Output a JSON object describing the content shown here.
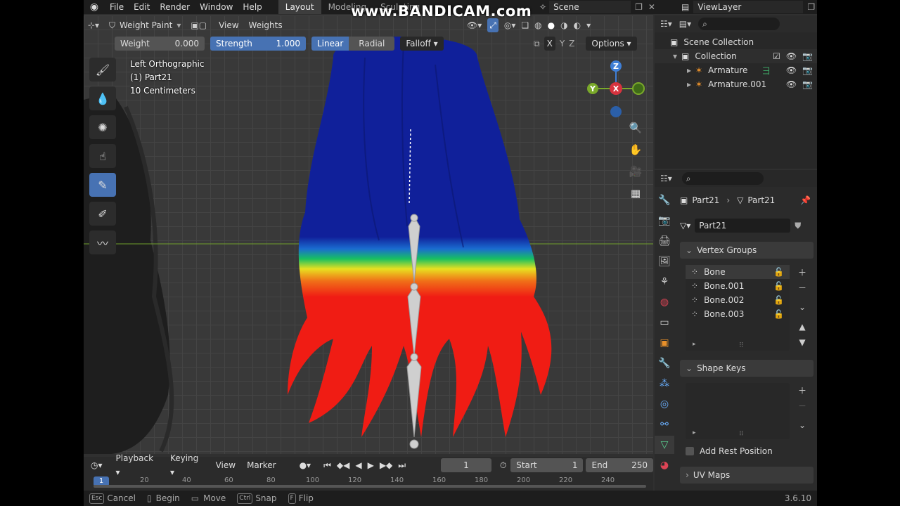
{
  "watermark": "www.BANDICAM.com",
  "topbar": {
    "menus": [
      "File",
      "Edit",
      "Render",
      "Window",
      "Help"
    ],
    "workspaces": [
      "Layout",
      "Modeling",
      "Sculpting"
    ],
    "scene": "Scene",
    "view_layer": "ViewLayer"
  },
  "viewport_header": {
    "mode": "Weight Paint",
    "view": "View",
    "weights": "Weights"
  },
  "tool_settings": {
    "weight_label": "Weight",
    "weight_value": "0.000",
    "strength_label": "Strength",
    "strength_value": "1.000",
    "linear": "Linear",
    "radial": "Radial",
    "falloff": "Falloff",
    "x": "X",
    "y": "Y",
    "z": "Z",
    "options": "Options"
  },
  "overlay": {
    "view_name": "Left Orthographic",
    "object": "(1) Part21",
    "scale": "10 Centimeters"
  },
  "gizmo": {
    "z": "Z",
    "y": "Y",
    "x": "X"
  },
  "outliner": {
    "scene_collection": "Scene Collection",
    "collection": "Collection",
    "items": [
      "Armature",
      "Armature.001"
    ]
  },
  "properties": {
    "breadcrumb_object": "Part21",
    "breadcrumb_mesh": "Part21",
    "mesh_name": "Part21",
    "vertex_groups_title": "Vertex Groups",
    "vertex_groups": [
      "Bone",
      "Bone.001",
      "Bone.002",
      "Bone.003"
    ],
    "shape_keys_title": "Shape Keys",
    "add_rest_position": "Add Rest Position",
    "uv_maps_title": "UV Maps"
  },
  "timeline": {
    "playback": "Playback",
    "keying": "Keying",
    "view": "View",
    "marker": "Marker",
    "current_frame": "1",
    "start_label": "Start",
    "start_value": "1",
    "end_label": "End",
    "end_value": "250",
    "ruler": [
      "1",
      "20",
      "40",
      "60",
      "80",
      "100",
      "120",
      "140",
      "160",
      "180",
      "200",
      "220",
      "240"
    ]
  },
  "status": {
    "esc_key": "Esc",
    "cancel": "Cancel",
    "begin": "Begin",
    "move": "Move",
    "ctrl_key": "Ctrl",
    "snap": "Snap",
    "f_key": "F",
    "flip": "Flip",
    "version": "3.6.10"
  },
  "colors": {
    "accent": "#4772b3",
    "weight_blue": "#10209a",
    "weight_red": "#f01c14"
  }
}
